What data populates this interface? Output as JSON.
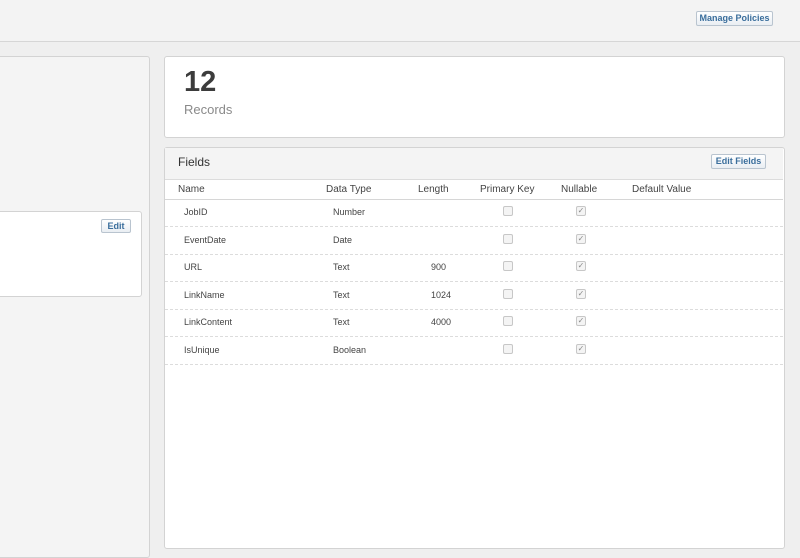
{
  "header": {
    "manage_policies_label": "Manage Policies"
  },
  "left_panel": {
    "edit_label": "Edit"
  },
  "records": {
    "count": "12",
    "label": "Records"
  },
  "fields": {
    "title": "Fields",
    "edit_fields_label": "Edit Fields",
    "columns": [
      "Name",
      "Data Type",
      "Length",
      "Primary Key",
      "Nullable",
      "Default Value"
    ],
    "rows": [
      {
        "name": "JobID",
        "type": "Number",
        "length": "",
        "primary_key": false,
        "nullable": true,
        "default": ""
      },
      {
        "name": "EventDate",
        "type": "Date",
        "length": "",
        "primary_key": false,
        "nullable": true,
        "default": ""
      },
      {
        "name": "URL",
        "type": "Text",
        "length": "900",
        "primary_key": false,
        "nullable": true,
        "default": ""
      },
      {
        "name": "LinkName",
        "type": "Text",
        "length": "1024",
        "primary_key": false,
        "nullable": true,
        "default": ""
      },
      {
        "name": "LinkContent",
        "type": "Text",
        "length": "4000",
        "primary_key": false,
        "nullable": true,
        "default": ""
      },
      {
        "name": "IsUnique",
        "type": "Boolean",
        "length": "",
        "primary_key": false,
        "nullable": true,
        "default": ""
      }
    ]
  },
  "colors": {
    "accent": "#3a6e9c",
    "panel_bg": "#f4f4f4",
    "border": "#d3d3d3"
  }
}
